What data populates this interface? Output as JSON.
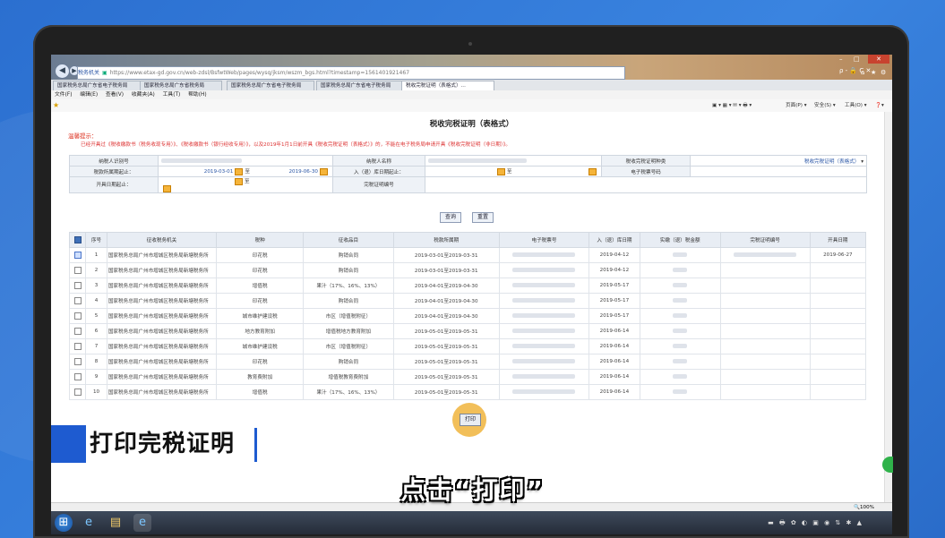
{
  "browser": {
    "address_site": "税务机关",
    "address_url": "https://www.etax-gd.gov.cn/web-zdsl/BsfwtWeb/pages/wysq/jksm/wszm_bgs.html?timestamp=1561401921467",
    "address_right": "ρ - 🔒 C ✕",
    "tabs": [
      "国家税务总局广东省电子税务局",
      "国家税务总局广东省税务局",
      "国家税务总局广东省电子税务局",
      "国家税务总局广东省电子税务局",
      "税收完税证明（表格式）..."
    ],
    "menu": [
      "文件(F)",
      "编辑(E)",
      "查看(V)",
      "收藏夹(A)",
      "工具(T)",
      "帮助(H)"
    ],
    "commands": [
      "页面(P) ▾",
      "安全(S) ▾",
      "工具(O) ▾"
    ],
    "zoom": "🔍100%"
  },
  "page": {
    "title": "税收完税证明（表格式）",
    "warn_label": "温馨提示：",
    "notice": "已经开具过《税收缴款书（税务收现专用）》、《税收缴款书（银行经收专用）》，以及2019年1月1日前开具《税收完税证明（表格式）》的，不能在电子税务局申请开具《税收完税证明（非日期）》。"
  },
  "form": {
    "taxpayer_id_label": "纳税人识别号",
    "taxpayer_name_label": "纳税人名称",
    "cert_type_label": "税收完税证明种类",
    "cert_type_value": "税收完税证明（表格式）",
    "period_label": "税款所属期起止：",
    "period_start": "2019-03-01",
    "period_to": "至",
    "period_end": "2019-06-30",
    "storage_date_label": "入（退）库日期起止：",
    "storage_to": "至",
    "ticket_no_label": "电子税票号码",
    "issue_date_label": "开具日期起止：",
    "issue_to": "至",
    "cert_no_label": "完税证明编号",
    "query_button": "查询",
    "reset_button": "重置"
  },
  "grid": {
    "headers": [
      "序号",
      "征收税务机关",
      "税种",
      "征收品目",
      "税款所属期",
      "电子税票号",
      "入（退）库日期",
      "实缴（退）税金额",
      "完税证明编号",
      "开具日期"
    ],
    "rows": [
      {
        "no": "1",
        "office": "国家税务总局广州市增城区税务局新塘税务所",
        "tax": "印花税",
        "item": "购销合同",
        "period": "2019-03-01至2019-03-31",
        "date": "2019-04-12",
        "issued": "2019-06-27",
        "checked": true
      },
      {
        "no": "2",
        "office": "国家税务总局广州市增城区税务局新塘税务所",
        "tax": "印花税",
        "item": "购销合同",
        "period": "2019-03-01至2019-03-31",
        "date": "2019-04-12",
        "issued": "",
        "checked": false
      },
      {
        "no": "3",
        "office": "国家税务总局广州市增城区税务局新塘税务所",
        "tax": "增值税",
        "item": "果汁（17%、16%、13%）",
        "period": "2019-04-01至2019-04-30",
        "date": "2019-05-17",
        "issued": "",
        "checked": false
      },
      {
        "no": "4",
        "office": "国家税务总局广州市增城区税务局新塘税务所",
        "tax": "印花税",
        "item": "购销合同",
        "period": "2019-04-01至2019-04-30",
        "date": "2019-05-17",
        "issued": "",
        "checked": false
      },
      {
        "no": "5",
        "office": "国家税务总局广州市增城区税务局新塘税务所",
        "tax": "城市维护建设税",
        "item": "市区（增值税附征）",
        "period": "2019-04-01至2019-04-30",
        "date": "2019-05-17",
        "issued": "",
        "checked": false
      },
      {
        "no": "6",
        "office": "国家税务总局广州市增城区税务局新塘税务所",
        "tax": "地方教育附加",
        "item": "增值税地方教育附加",
        "period": "2019-05-01至2019-05-31",
        "date": "2019-06-14",
        "issued": "",
        "checked": false
      },
      {
        "no": "7",
        "office": "国家税务总局广州市增城区税务局新塘税务所",
        "tax": "城市维护建设税",
        "item": "市区（增值税附征）",
        "period": "2019-05-01至2019-05-31",
        "date": "2019-06-14",
        "issued": "",
        "checked": false
      },
      {
        "no": "8",
        "office": "国家税务总局广州市增城区税务局新塘税务所",
        "tax": "印花税",
        "item": "购销合同",
        "period": "2019-05-01至2019-05-31",
        "date": "2019-06-14",
        "issued": "",
        "checked": false
      },
      {
        "no": "9",
        "office": "国家税务总局广州市增城区税务局新塘税务所",
        "tax": "教育费附加",
        "item": "增值税教育费附加",
        "period": "2019-05-01至2019-05-31",
        "date": "2019-06-14",
        "issued": "",
        "checked": false
      },
      {
        "no": "10",
        "office": "国家税务总局广州市增城区税务局新塘税务所",
        "tax": "增值税",
        "item": "果汁（17%、16%、13%）",
        "period": "2019-05-01至2019-05-31",
        "date": "2019-06-14",
        "issued": "",
        "checked": false
      }
    ]
  },
  "overlay": {
    "section_caption": "打印完税证明",
    "subtitle": "点击“打印”",
    "print_button": "打印"
  }
}
